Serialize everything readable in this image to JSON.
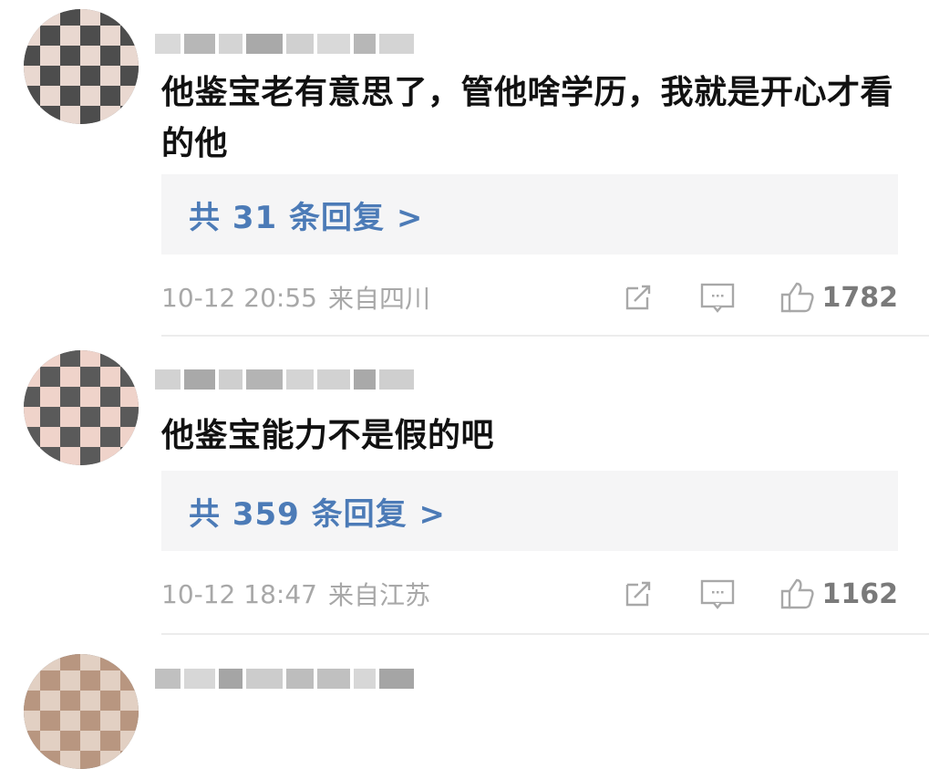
{
  "comments": [
    {
      "text": "他鉴宝老有意思了，管他啥学历，我就是开心才看的他",
      "reply_label": "共 31 条回复 >",
      "time": "10-12 20:55",
      "location": "来自四川",
      "likes": "1782",
      "avatar_colors": [
        "#4d4d4d",
        "#8d8d8d",
        "#c7c7c7",
        "#e9d8d0",
        "#6d6d6d",
        "#b9a7a0"
      ],
      "username_blur_colors": [
        "#d9d9d9",
        "#b7b7b7",
        "#d4d4d4",
        "#a9a9a9",
        "#d0d0d0"
      ]
    },
    {
      "text": "他鉴宝能力不是假的吧",
      "reply_label": "共 359 条回复 >",
      "time": "10-12 18:47",
      "location": "来自江苏",
      "likes": "1162",
      "avatar_colors": [
        "#5a5a5a",
        "#7a7a7a",
        "#c48d86",
        "#efd3ca",
        "#8b6d66",
        "#3f3f3f"
      ],
      "username_blur_colors": [
        "#d2d2d2",
        "#a9a9a9",
        "#cfcfcf",
        "#b4b4b4",
        "#d4d4d4"
      ]
    },
    {
      "text": "",
      "reply_label": "",
      "time": "",
      "location": "",
      "likes": "",
      "avatar_colors": [
        "#b89680",
        "#d3b099",
        "#8f7464",
        "#e2d0c3",
        "#a1887a",
        "#c7ab98"
      ],
      "username_blur_colors": [
        "#c0c0c0",
        "#d7d7d7",
        "#a5a5a5",
        "#cccccc",
        "#bdbdbd"
      ]
    }
  ],
  "icons": {
    "share": "share-icon",
    "comment": "comment-icon",
    "like": "like-icon"
  },
  "colors": {
    "reply_link": "#4c7bb7",
    "meta": "#a8a8a8",
    "reply_bg": "#f5f5f6"
  }
}
